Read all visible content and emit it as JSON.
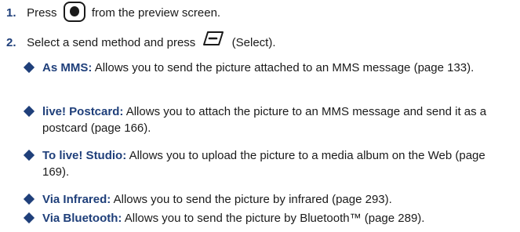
{
  "steps": [
    {
      "number": "1.",
      "before": "Press",
      "after": "from the preview screen.",
      "icon": "center-select-key-icon"
    },
    {
      "number": "2.",
      "before": "Select a send method and press",
      "after": "(Select).",
      "icon": "left-soft-key-icon"
    }
  ],
  "options": [
    {
      "term": "As MMS:",
      "description": "Allows you to send the picture attached to an MMS message (page 133)."
    },
    {
      "term": "live! Postcard:",
      "description": "Allows you to attach the picture to an MMS message and send it as a postcard (page 166)."
    },
    {
      "term": "To live! Studio:",
      "description": "Allows you to upload the picture to a media album on the Web (page 169)."
    },
    {
      "term": "Via Infrared:",
      "description": "Allows you to send the picture by infrared (page 293)."
    },
    {
      "term": "Via Bluetooth:",
      "description": "Allows you to send the picture by Bluetooth™ (page 289)."
    }
  ],
  "colors": {
    "accent": "#1f3f7a",
    "text": "#1a1a1a"
  }
}
